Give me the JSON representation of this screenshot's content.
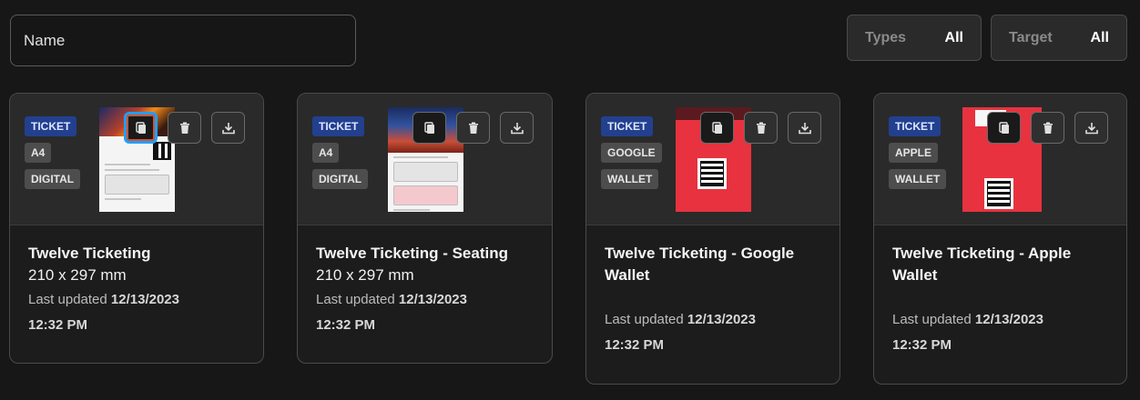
{
  "search": {
    "placeholder": "Name"
  },
  "filters": {
    "types": {
      "label": "Types",
      "value": "All"
    },
    "target": {
      "label": "Target",
      "value": "All"
    }
  },
  "cards": [
    {
      "badges": [
        "TICKET",
        "A4",
        "DIGITAL"
      ],
      "title": "Twelve Ticketing",
      "dims": "210 x 297 mm",
      "updated_label": "Last updated",
      "updated_date": "12/13/2023",
      "updated_time": "12:32 PM"
    },
    {
      "badges": [
        "TICKET",
        "A4",
        "DIGITAL"
      ],
      "title": "Twelve Ticketing - Seating",
      "dims": "210 x 297 mm",
      "updated_label": "Last updated",
      "updated_date": "12/13/2023",
      "updated_time": "12:32 PM"
    },
    {
      "badges": [
        "TICKET",
        "GOOGLE",
        "WALLET"
      ],
      "title": "Twelve Ticketing - Google Wallet",
      "updated_label": "Last updated",
      "updated_date": "12/13/2023",
      "updated_time": "12:32 PM"
    },
    {
      "badges": [
        "TICKET",
        "APPLE",
        "WALLET"
      ],
      "title": "Twelve Ticketing - Apple Wallet",
      "updated_label": "Last updated",
      "updated_date": "12/13/2023",
      "updated_time": "12:32 PM"
    }
  ],
  "icons": {
    "copy": "copy-icon",
    "delete": "trash-icon",
    "download": "download-icon"
  },
  "colors": {
    "primary_badge": "#23408f",
    "highlight": "#1ea0ff",
    "wallet_red": "#e8323f"
  }
}
